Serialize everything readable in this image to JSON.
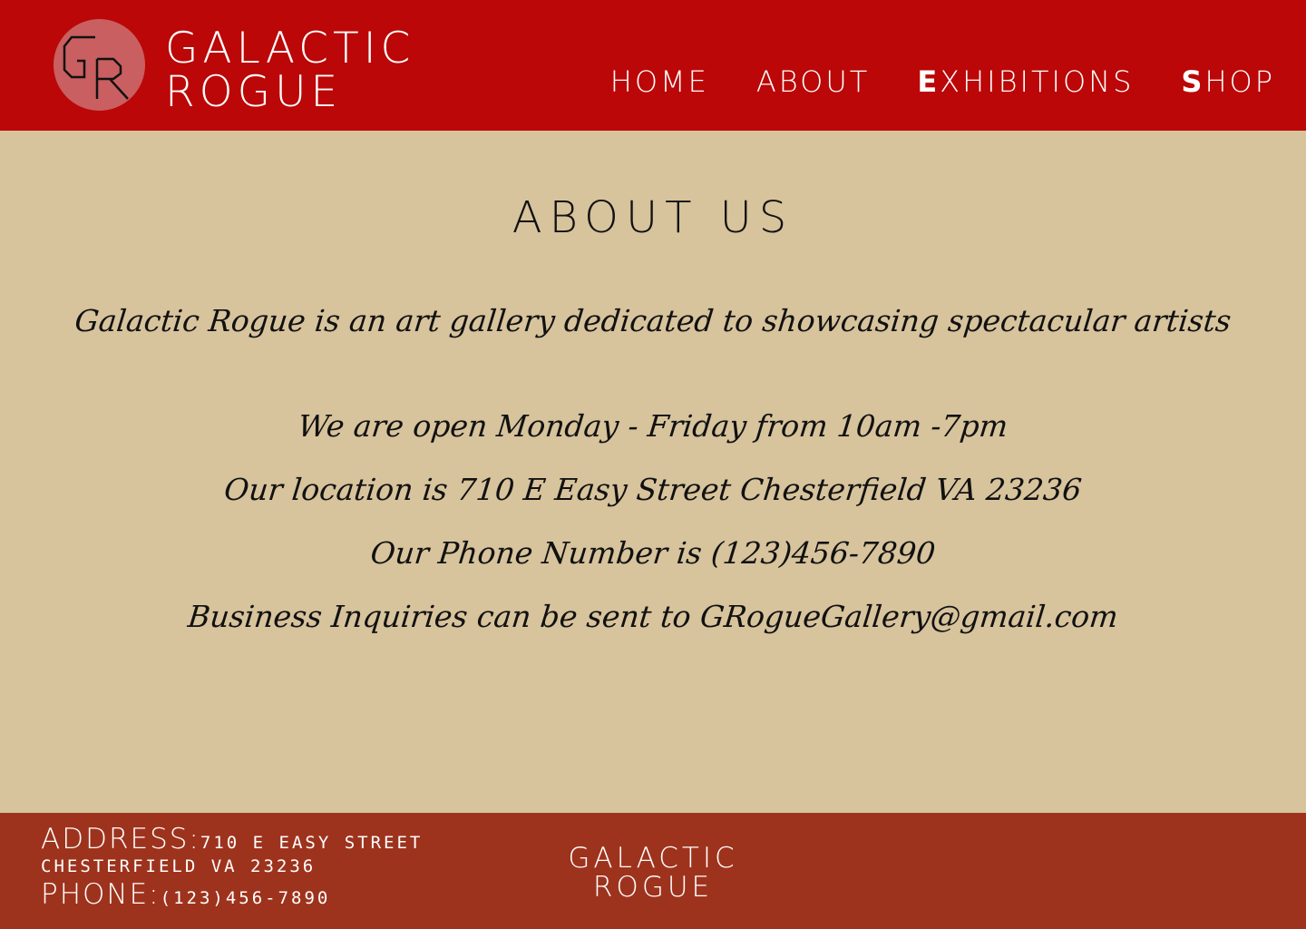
{
  "header": {
    "brand_line1": "GALACTIC",
    "brand_line2": "ROGUE",
    "logo_icon": "gr-monogram-logo",
    "nav": [
      {
        "label": "HOME"
      },
      {
        "label": "ABOUT"
      },
      {
        "label": "EXHIBITIONS"
      },
      {
        "label": "SHOP"
      }
    ]
  },
  "main": {
    "title": "ABOUT US",
    "intro": "Galactic Rogue is an art gallery dedicated to showcasing spectacular artists",
    "hours": "We are open Monday - Friday from 10am -7pm",
    "location": "Our location is 710 E Easy Street Chesterfield VA 23236",
    "phone": "Our Phone Number is (123)456-7890",
    "inquiries": "Business Inquiries can be sent to GRogueGallery@gmail.com"
  },
  "footer": {
    "address_label": "ADDRESS:",
    "address_line1": "710 E EASY STREET",
    "address_line2": "CHESTERFIELD VA 23236",
    "phone_label": "PHONE:",
    "phone_value": "(123)456-7890",
    "brand_line1": "GALACTIC",
    "brand_line2": "ROGUE"
  },
  "colors": {
    "header_bg": "#bb0707",
    "page_bg": "#d7c39c",
    "footer_bg": "#9e331d",
    "logo_circle": "#c95f60",
    "text_light": "#ffffff",
    "text_dark": "#111111"
  }
}
